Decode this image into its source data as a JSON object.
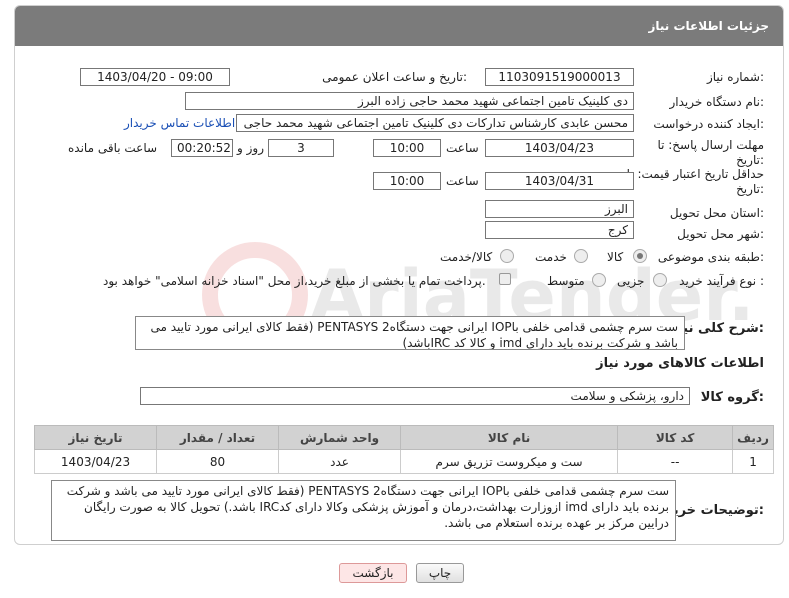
{
  "header": {
    "title": "جزئیات اطلاعات نیاز"
  },
  "fields": {
    "need_number_label": "شماره نیاز:",
    "need_number": "1103091519000013",
    "announce_label": "تاریخ و ساعت اعلان عمومی:",
    "announce_value": "1403/04/20 - 09:00",
    "buyer_org_label": "نام دستگاه خریدار:",
    "buyer_org": "دی کلینیک تامین اجتماعی شهید محمد حاجی زاده البرز",
    "creator_label": "ایجاد کننده درخواست:",
    "creator": "محسن عابدی کارشناس تدارکات دی کلینیک تامین اجتماعی شهید محمد حاجی",
    "contact_link": "اطلاعات تماس خریدار",
    "deadline_label_1": "مهلت ارسال پاسخ: تا",
    "deadline_label_2": "تاریخ:",
    "deadline_date": "1403/04/23",
    "time_label": "ساعت",
    "deadline_time": "10:00",
    "days_value": "3",
    "days_label": "روز و",
    "remaining_value": "00:20:52",
    "remaining_label": "ساعت باقی مانده",
    "validity_label_1": "حداقل تاریخ اعتبار قیمت: تا",
    "validity_label_2": "تاریخ:",
    "validity_date": "1403/04/31",
    "validity_time": "10:00",
    "province_label": "استان محل تحویل:",
    "province": "البرز",
    "city_label": "شهر محل تحویل:",
    "city": "کرج",
    "category_label": "طبقه بندی موضوعی:",
    "category_options": [
      "کالا",
      "خدمت",
      "کالا/خدمت"
    ],
    "category_selected": "کالا",
    "process_label": "نوع فرآیند خرید :",
    "process_options": [
      "جزیی",
      "متوسط"
    ],
    "process_note": "پرداخت تمام یا بخشی از مبلغ خرید،از محل \"اسناد خزانه اسلامی\" خواهد بود."
  },
  "summary": {
    "label": "شرح کلی نیاز:",
    "text": "ست سرم چشمی قدامی خلفی باIOP ایرانی جهت دستگاهPENTASYS 2 (فقط کالای ایرانی مورد تایید می باشد و شرکت برنده  باید دارای imd و کالا کد IRCباشد)"
  },
  "goods_section": {
    "title": "اطلاعات کالاهای مورد نیاز",
    "group_label": "گروه کالا:",
    "group_value": "دارو، پزشکی و سلامت"
  },
  "table": {
    "headers": [
      "ردیف",
      "کد کالا",
      "نام کالا",
      "واحد شمارش",
      "تعداد / مقدار",
      "تاریخ نیاز"
    ],
    "rows": [
      [
        "1",
        "--",
        "ست و میکروست تزریق سرم",
        "عدد",
        "80",
        "1403/04/23"
      ]
    ]
  },
  "buyer_notes": {
    "label": "توضیحات خریدار:",
    "text": "ست سرم چشمی قدامی خلفی باIOP ایرانی جهت دستگاهPENTASYS 2 (فقط کالای ایرانی مورد تایید می باشد و شرکت برنده  باید دارای imd ازوزارت بهداشت،درمان و آموزش پزشکی وکالا دارای کدIRC باشد.) تحویل کالا به صورت رایگان درایین مرکز بر عهده برنده استعلام می باشد."
  },
  "buttons": {
    "print": "چاپ",
    "back": "بازگشت"
  },
  "watermark": {
    "text": "AriaTender.neT"
  }
}
